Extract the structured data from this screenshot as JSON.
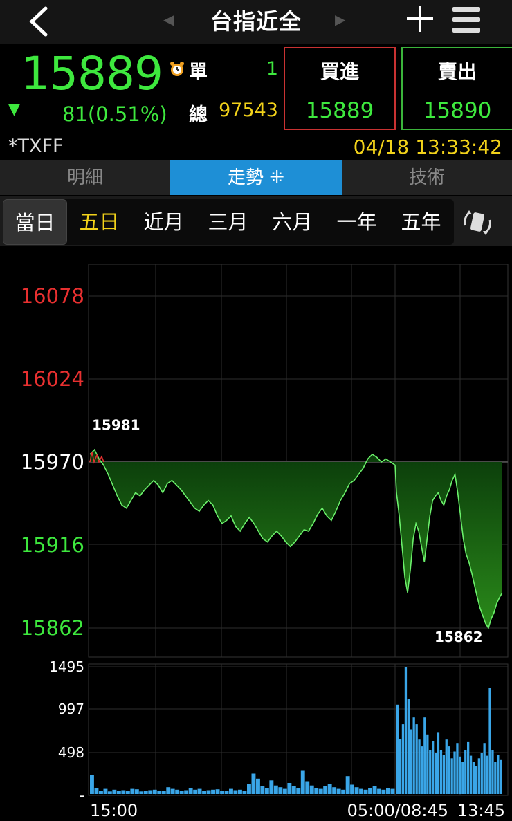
{
  "header": {
    "title": "台指近全"
  },
  "quote": {
    "price": "15889",
    "change": "81(0.51%)",
    "single_label": "單",
    "single_value": "1",
    "total_label": "總",
    "total_value": "97543",
    "buy_label": "買進",
    "buy_value": "15889",
    "sell_label": "賣出",
    "sell_value": "15890",
    "symbol": "*TXFF",
    "datetime": "04/18 13:33:42"
  },
  "tabs": [
    {
      "label": "明細"
    },
    {
      "label": "走勢 ⁜"
    },
    {
      "label": "技術"
    }
  ],
  "ranges": [
    "當日",
    "五日",
    "近月",
    "三月",
    "六月",
    "一年",
    "五年"
  ],
  "colors": {
    "up": "#e83030",
    "down": "#3ee83e",
    "accent": "#1e8fd6",
    "highlight": "#f2d21a",
    "volume": "#3aa6e8"
  },
  "chart_data": [
    {
      "type": "area",
      "title": "",
      "y_ticks": [
        "16078",
        "16024",
        "15970",
        "15916",
        "15862"
      ],
      "ylim": [
        15840,
        16100
      ],
      "reference": 15970,
      "annotations": [
        {
          "label": "15981",
          "value": 15981,
          "note": "high"
        },
        {
          "label": "15862",
          "value": 15862,
          "note": "low"
        }
      ],
      "grid": true,
      "sessions": [
        {
          "name": "night",
          "values": [
            15975,
            15978,
            15972,
            15968,
            15962,
            15955,
            15948,
            15942,
            15940,
            15945,
            15950,
            15948,
            15952,
            15955,
            15958,
            15955,
            15950,
            15956,
            15958,
            15955,
            15952,
            15948,
            15944,
            15940,
            15938,
            15942,
            15945,
            15942,
            15935,
            15930,
            15932,
            15935,
            15928,
            15925,
            15930,
            15934,
            15930,
            15925,
            15920,
            15918,
            15922,
            15925,
            15922,
            15918,
            15915,
            15918,
            15922,
            15926,
            15925,
            15930,
            15936,
            15940,
            15935,
            15932,
            15938,
            15945,
            15950,
            15956,
            15958,
            15962,
            15966,
            15972,
            15975,
            15973,
            15970,
            15972,
            15970,
            15968
          ]
        },
        {
          "name": "day",
          "values": [
            15950,
            15935,
            15915,
            15895,
            15885,
            15900,
            15920,
            15930,
            15925,
            15915,
            15905,
            15920,
            15935,
            15945,
            15948,
            15950,
            15945,
            15942,
            15948,
            15952,
            15958,
            15962,
            15950,
            15935,
            15920,
            15910,
            15905,
            15898,
            15890,
            15882,
            15875,
            15870,
            15865,
            15862,
            15868,
            15872,
            15878,
            15882,
            15885
          ]
        }
      ],
      "x_labels": [
        "15:00",
        "05:00/08:45",
        "13:45"
      ]
    },
    {
      "type": "bar",
      "y_ticks": [
        "1495",
        "997",
        "498",
        "-"
      ],
      "ylim": [
        0,
        1495
      ],
      "x_labels": [
        "15:00",
        "05:00/08:45",
        "13:45"
      ],
      "sessions": [
        {
          "name": "night",
          "values": [
            220,
            70,
            40,
            60,
            30,
            50,
            35,
            45,
            40,
            60,
            55,
            30,
            40,
            45,
            50,
            35,
            40,
            80,
            60,
            50,
            40,
            45,
            70,
            50,
            60,
            40,
            45,
            50,
            55,
            40,
            35,
            60,
            45,
            50,
            40,
            120,
            240,
            180,
            90,
            70,
            160,
            100,
            80,
            60,
            130,
            90,
            70,
            280,
            150,
            100,
            70,
            60,
            90,
            120,
            80,
            60,
            50,
            210,
            110,
            80,
            60,
            50,
            70,
            90,
            60,
            50,
            70,
            60
          ]
        },
        {
          "name": "day",
          "values": [
            1050,
            650,
            820,
            1495,
            1120,
            760,
            900,
            820,
            640,
            560,
            900,
            700,
            520,
            620,
            480,
            720,
            520,
            460,
            640,
            560,
            420,
            500,
            600,
            440,
            380,
            520,
            610,
            450,
            380,
            330,
            420,
            480,
            600,
            450,
            1250,
            520,
            380,
            460,
            400
          ]
        }
      ]
    }
  ]
}
